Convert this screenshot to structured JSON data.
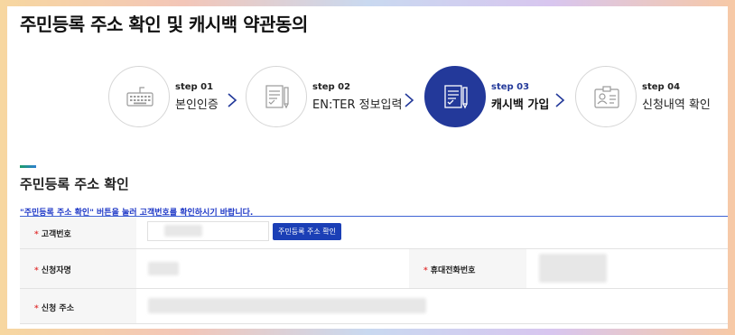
{
  "page_title": "주민등록 주소 확인 및 캐시백 약관동의",
  "steps": [
    {
      "no": "step 01",
      "name": "본인인증",
      "icon": "keyboard-icon",
      "active": false
    },
    {
      "no": "step 02",
      "name": "EN:TER 정보입력",
      "icon": "document-pen-icon",
      "active": false
    },
    {
      "no": "step 03",
      "name": "캐시백 가입",
      "icon": "document-pen-icon",
      "active": true
    },
    {
      "no": "step 04",
      "name": "신청내역 확인",
      "icon": "id-card-icon",
      "active": false
    }
  ],
  "section": {
    "title": "주민등록 주소 확인",
    "notice": "\"주민등록 주소 확인\" 버튼을 눌러 고객번호를 확인하시기 바랍니다."
  },
  "form": {
    "required_mark": "*",
    "customer_no_label": "고객번호",
    "verify_button": "주민등록 주소 확인",
    "applicant_label": "신청자명",
    "phone_label": "휴대전화번호",
    "address_label": "신청 주소"
  },
  "colors": {
    "accent": "#23399a",
    "notice": "#1c36c6",
    "required": "#e23b3b",
    "button": "#1b3fb6"
  }
}
